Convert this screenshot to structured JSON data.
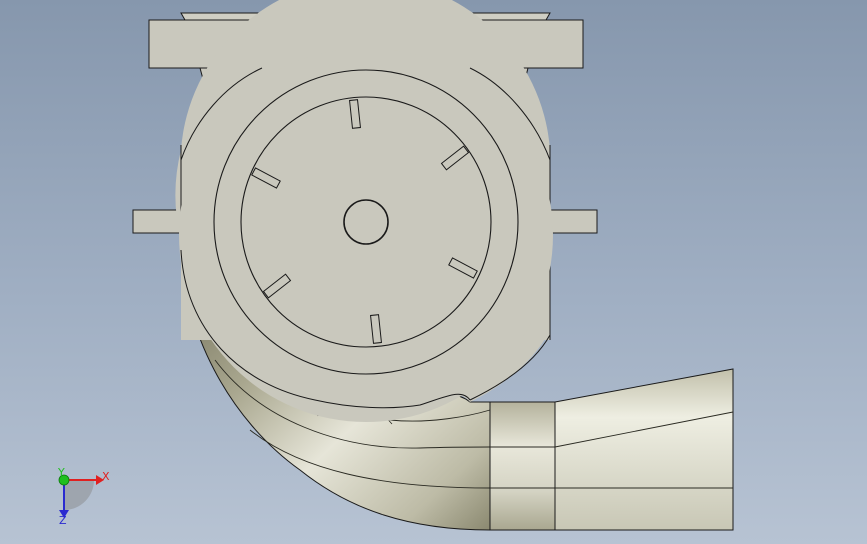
{
  "viewport": {
    "background_top": "#8697ad",
    "background_bottom": "#b7c3d3"
  },
  "model": {
    "part_color": "#c9c8bd",
    "edge_color": "#1a1a1a",
    "pipe_light": "#e4e3d6",
    "pipe_dark": "#6e6c58"
  },
  "triad": {
    "x_label": "X",
    "y_label": "Y",
    "z_label": "Z",
    "x_color": "#e02020",
    "y_color": "#1fbf1f",
    "z_color": "#2a2ad0"
  }
}
